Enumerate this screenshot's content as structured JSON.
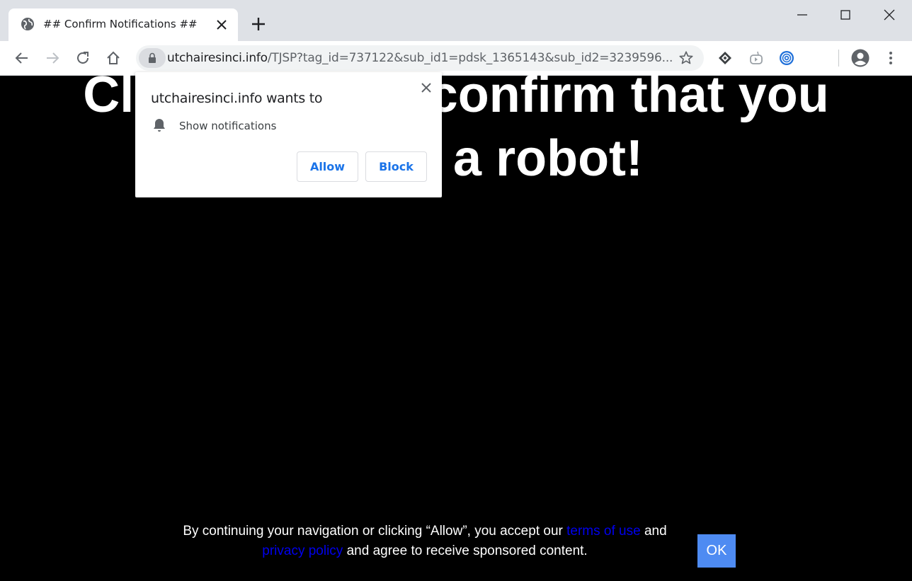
{
  "tab": {
    "title": "## Confirm Notifications ##"
  },
  "address": {
    "host": "utchairesinci.info",
    "path": "/TJSP?tag_id=737122&sub_id1=pdsk_1365143&sub_id2=3239596..."
  },
  "page": {
    "headline_line1": "Click Allow to confirm that you",
    "headline_line2": "are not a robot!",
    "consent_text1": "By continuing your navigation or clicking “Allow”, you accept our ",
    "terms_link": "terms of use",
    "consent_and": " and",
    "privacy_link": "privacy policy",
    "consent_text2": " and agree to receive sponsored content.",
    "ok_label": "OK"
  },
  "popup": {
    "title": "utchairesinci.info wants to",
    "permission": "Show notifications",
    "allow_label": "Allow",
    "block_label": "Block"
  },
  "colors": {
    "accent": "#1a73e8",
    "ok_button": "#4e8bf2",
    "link": "#0000ee",
    "tabstrip": "#dee1e6"
  },
  "icons": {
    "tab": [
      "globe-icon",
      "close-icon"
    ],
    "toolbar": [
      "back-icon",
      "forward-icon",
      "reload-icon",
      "home-icon",
      "lock-icon",
      "star-icon",
      "extension-icon",
      "profile-icon",
      "menu-icon"
    ],
    "popup": [
      "bell-icon",
      "close-icon"
    ]
  }
}
